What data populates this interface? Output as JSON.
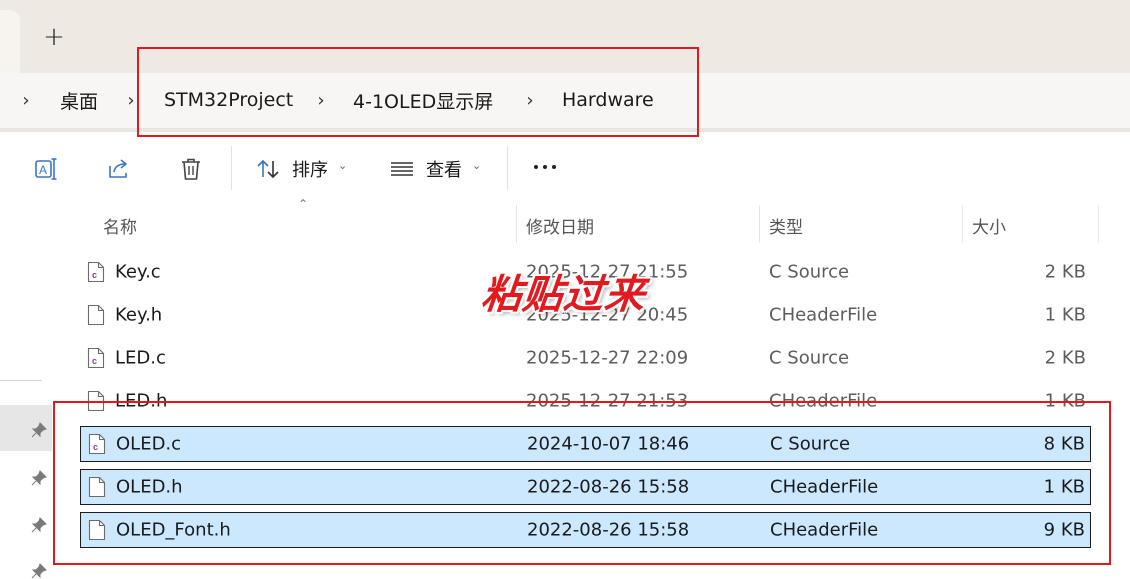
{
  "tabbar": {
    "new_tab_label": "+"
  },
  "breadcrumb": {
    "items": [
      "桌面",
      "STM32Project",
      "4-1OLED显示屏",
      "Hardware"
    ],
    "separator": "›"
  },
  "toolbar": {
    "sort_label": "排序",
    "view_label": "查看",
    "icons": [
      "rename-icon",
      "share-icon",
      "delete-icon",
      "sort-icon",
      "view-icon",
      "more-icon"
    ]
  },
  "columns": {
    "name": "名称",
    "date": "修改日期",
    "type": "类型",
    "size": "大小"
  },
  "files": [
    {
      "name": "Key.c",
      "date": "2025-12-27 21:55",
      "type": "C Source",
      "size": "2 KB",
      "icon": "c-source-file-icon",
      "selected": false
    },
    {
      "name": "Key.h",
      "date": "2025-12-27 20:45",
      "type": "CHeaderFile",
      "size": "1 KB",
      "icon": "header-file-icon",
      "selected": false
    },
    {
      "name": "LED.c",
      "date": "2025-12-27 22:09",
      "type": "C Source",
      "size": "2 KB",
      "icon": "c-source-file-icon",
      "selected": false
    },
    {
      "name": "LED.h",
      "date": "2025-12-27 21:53",
      "type": "CHeaderFile",
      "size": "1 KB",
      "icon": "header-file-icon",
      "selected": false
    },
    {
      "name": "OLED.c",
      "date": "2024-10-07 18:46",
      "type": "C Source",
      "size": "8 KB",
      "icon": "c-source-file-icon",
      "selected": true
    },
    {
      "name": "OLED.h",
      "date": "2022-08-26 15:58",
      "type": "CHeaderFile",
      "size": "1 KB",
      "icon": "header-file-icon",
      "selected": true
    },
    {
      "name": "OLED_Font.h",
      "date": "2022-08-26 15:58",
      "type": "CHeaderFile",
      "size": "9 KB",
      "icon": "header-file-icon",
      "selected": true
    }
  ],
  "annotation": {
    "stamp_text": "粘贴过来"
  },
  "colors": {
    "selection": "#cce8ff",
    "annotation_red": "#e0191f",
    "c_icon_accent": "#8a3b8f"
  }
}
